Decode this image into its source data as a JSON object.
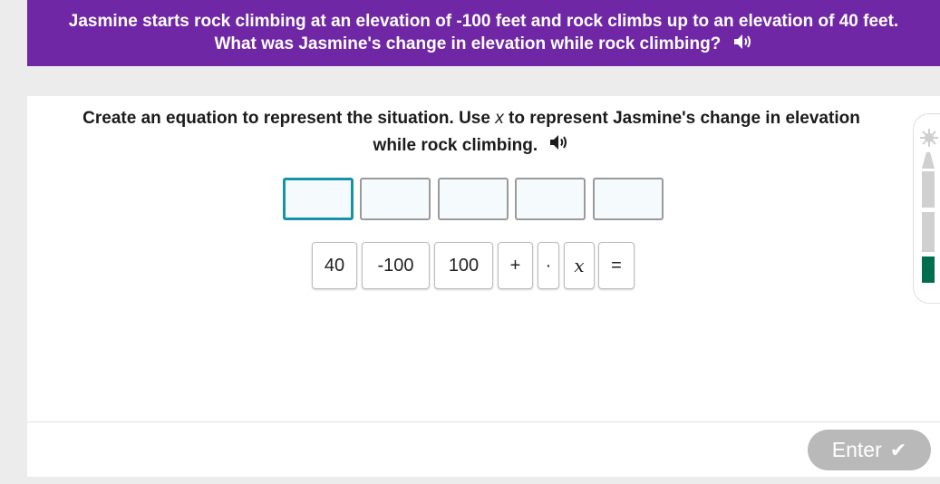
{
  "banner": {
    "text": "Jasmine starts rock climbing at an elevation of -100 feet and rock climbs up to an elevation of 40 feet. What was Jasmine's change in elevation while rock climbing?",
    "speaker_icon": "speaker-icon"
  },
  "instructions": {
    "part1": "Create an equation to represent the situation. Use ",
    "variable": "x",
    "part2": " to represent Jasmine's change in elevation while rock climbing.",
    "speaker_icon": "speaker-icon"
  },
  "answer_slots": {
    "count": 5,
    "active_index": 0
  },
  "tiles": [
    "40",
    "-100",
    "100",
    "+",
    "·",
    "x",
    "="
  ],
  "enter_button": {
    "label": "Enter",
    "icon": "checkmark-icon"
  },
  "progress": {
    "star_icon": "star-icon",
    "segments": [
      {
        "color": "#d0d0d0"
      },
      {
        "color": "#d0d0d0"
      },
      {
        "color": "#d0d0d0"
      },
      {
        "color": "#006d4f"
      }
    ]
  },
  "colors": {
    "banner": "#7027a5",
    "active_slot_border": "#1693a5",
    "enter_disabled": "#b9b9b9",
    "progress_complete": "#006d4f"
  }
}
